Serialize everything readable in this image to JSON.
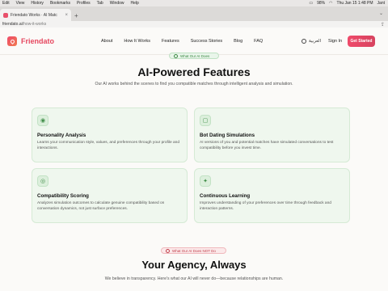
{
  "system_menubar": {
    "items": [
      "Edit",
      "View",
      "History",
      "Bookmarks",
      "Profiles",
      "Tab",
      "Window",
      "Help"
    ],
    "battery": "98%",
    "datetime": "Thu Jan 15  1:48 PM",
    "user": "Jant"
  },
  "browser": {
    "tab_title": "Friendato Works · AI Matc",
    "url_host": "friendato.ai",
    "url_path": "/how-it-works"
  },
  "site_nav": {
    "logo": "Friendato",
    "links": [
      "About",
      "How It Works",
      "Features",
      "Success Stories",
      "Blog",
      "FAQ"
    ],
    "language": "العربية",
    "sign_in": "Sign In",
    "get_started": "Get Started"
  },
  "features_section": {
    "badge": "What Our AI Does",
    "title": "AI-Powered Features",
    "subtitle": "Our AI works behind the scenes to find you compatible matches through intelligent analysis and simulation.",
    "cards": [
      {
        "icon": "brain-icon",
        "title": "Personality Analysis",
        "desc": "Learns your communication style, values, and preferences through your profile and interactions."
      },
      {
        "icon": "chat-icon",
        "title": "Bot Dating Simulations",
        "desc": "AI versions of you and potential matches have simulated conversations to test compatibility before you invest time."
      },
      {
        "icon": "target-icon",
        "title": "Compatibility Scoring",
        "desc": "Analyzes simulation outcomes to calculate genuine compatibility based on conversation dynamics, not just surface preferences."
      },
      {
        "icon": "sparkle-icon",
        "title": "Continuous Learning",
        "desc": "Improves understanding of your preferences over time through feedback and interaction patterns."
      }
    ]
  },
  "agency_section": {
    "badge": "What Our AI Does NOT Do",
    "title": "Your Agency, Always",
    "subtitle": "We believe in transparency. Here's what our AI will never do—because relationships are human."
  },
  "colors": {
    "brand": "#e6475f",
    "card_bg": "#eff7ee",
    "green_accent": "#3d8a45",
    "red_accent": "#c1414d"
  }
}
